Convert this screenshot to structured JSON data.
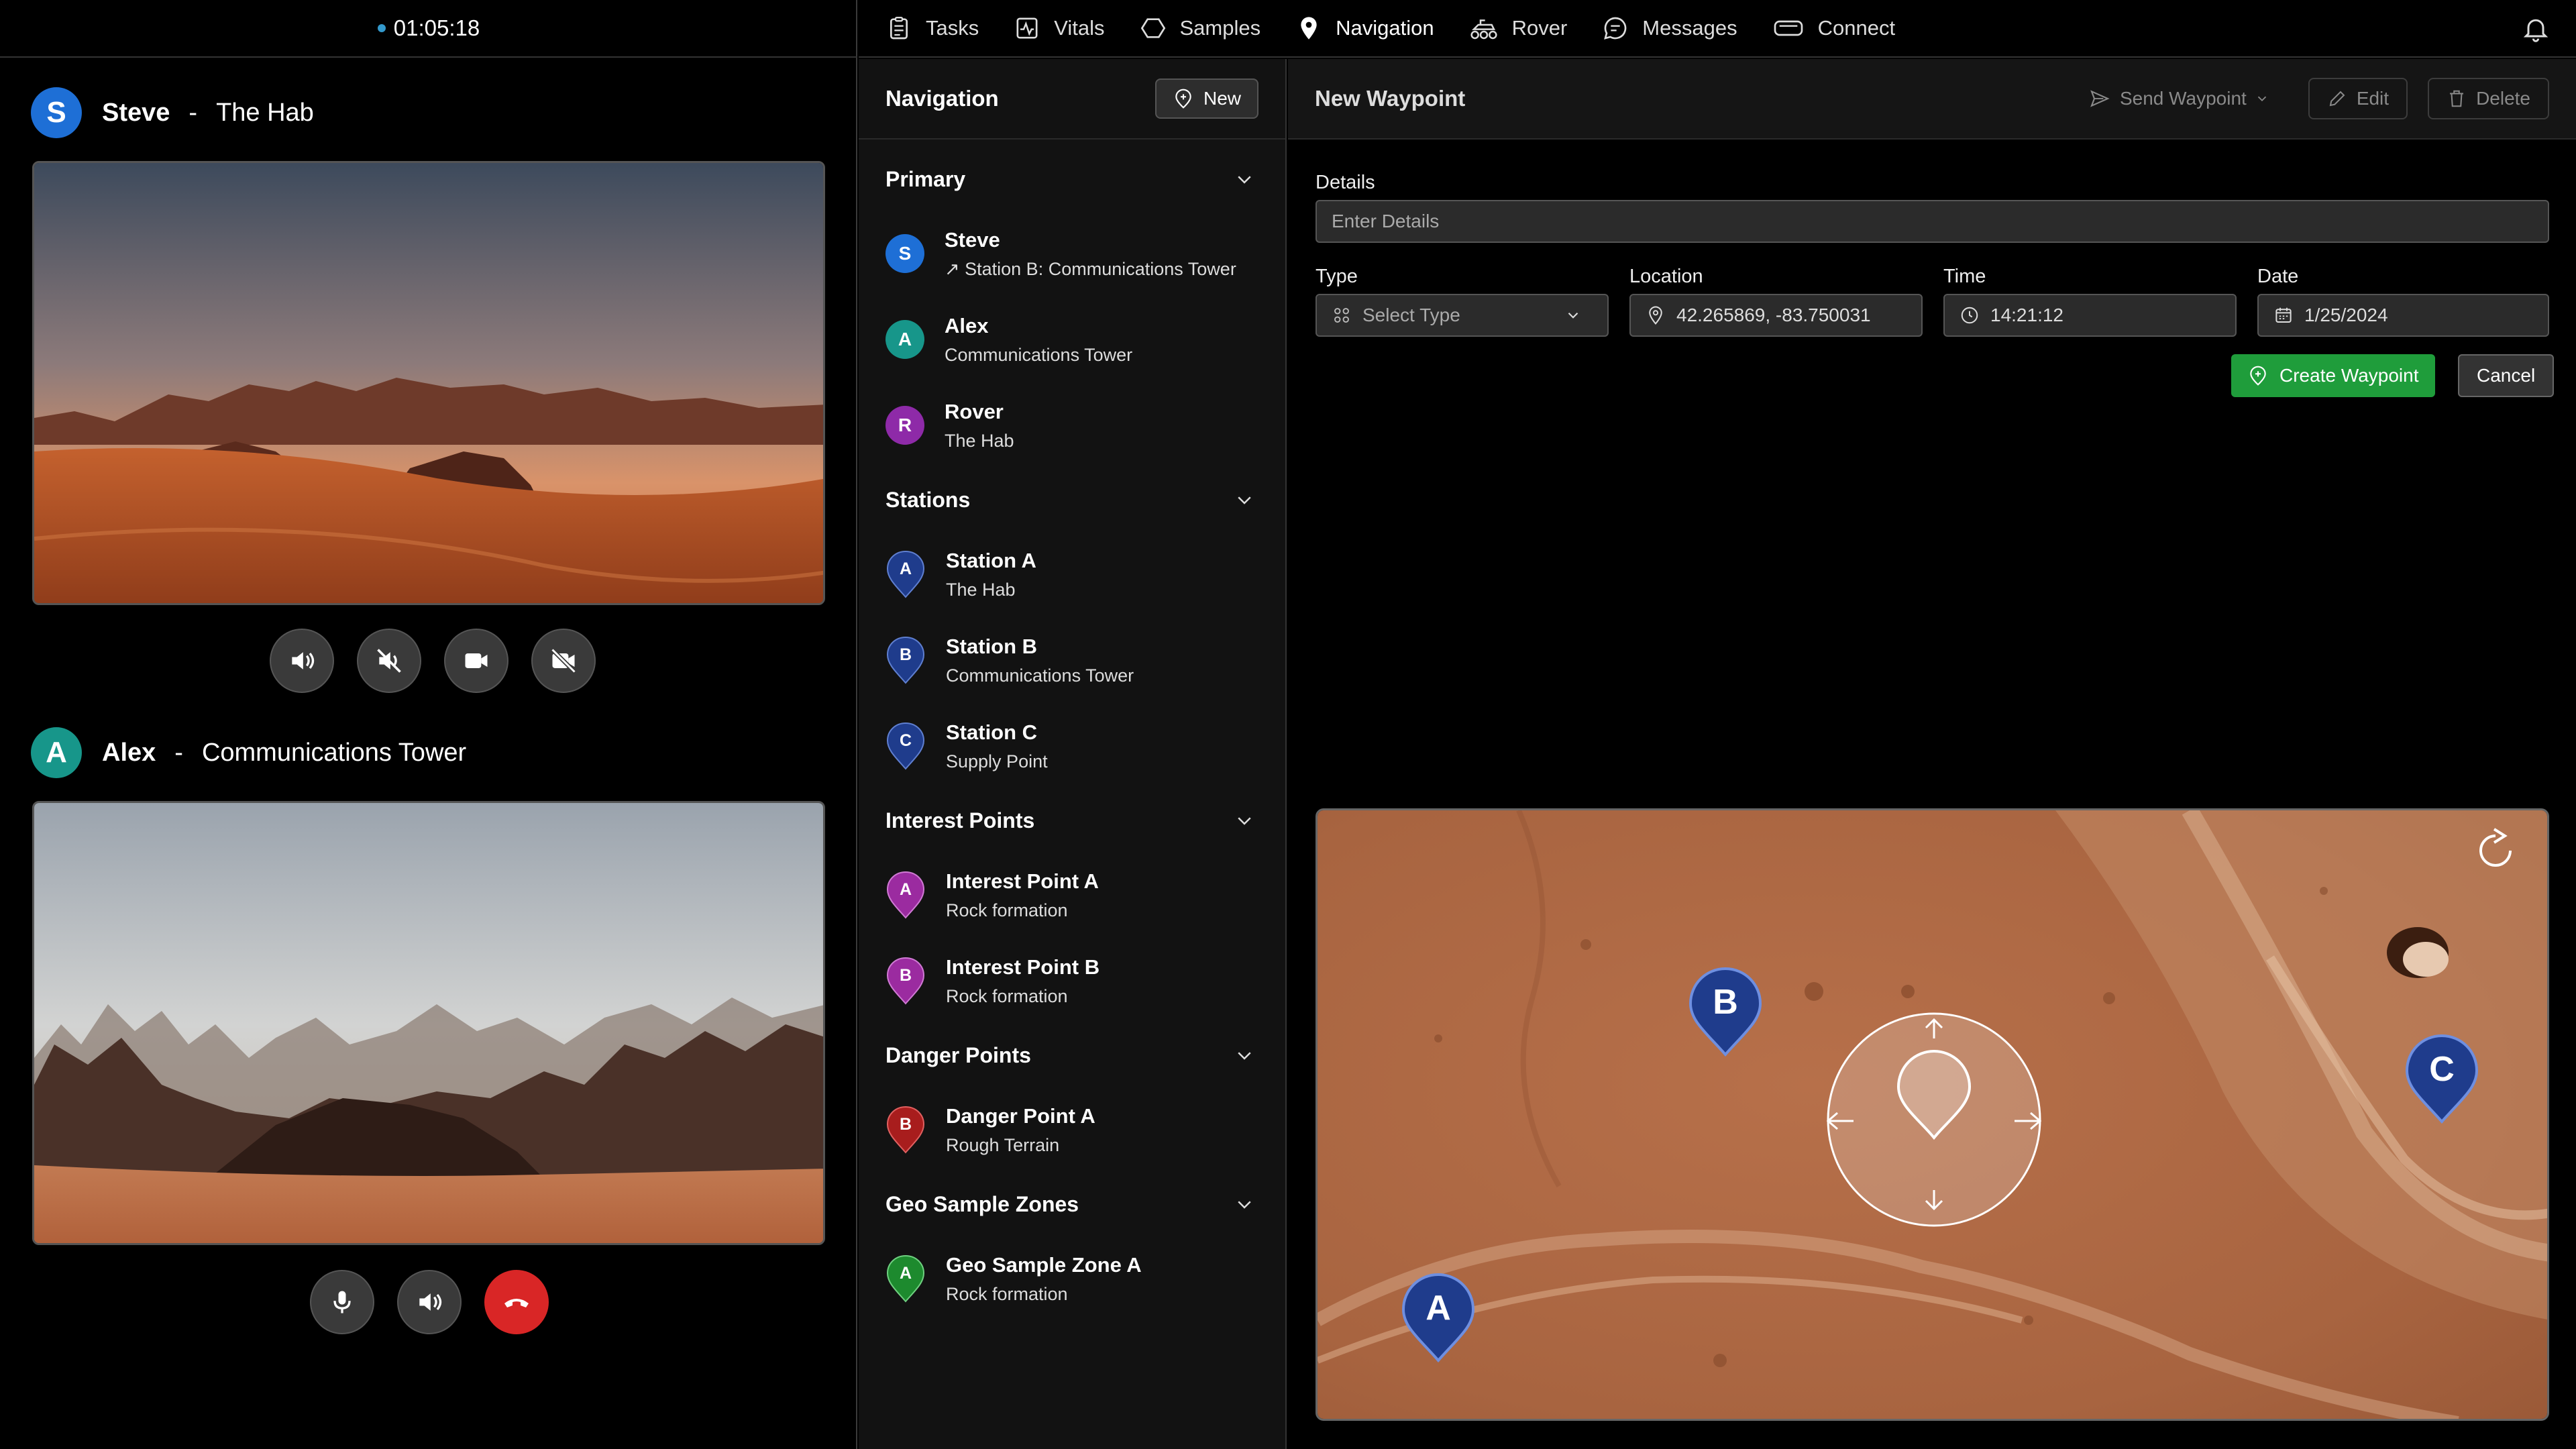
{
  "call": {
    "timer": "01:05:18",
    "callers": [
      {
        "initial": "S",
        "name": "Steve",
        "separator": "-",
        "location": "The Hab",
        "color": "#1e6fd6"
      },
      {
        "initial": "A",
        "name": "Alex",
        "separator": "-",
        "location": "Communications Tower",
        "color": "#17968a"
      }
    ],
    "controls_1": [
      "speaker-icon",
      "speaker-muted-icon",
      "camera-icon",
      "camera-off-icon"
    ],
    "controls_2": [
      "microphone-icon",
      "speaker-icon",
      "hang-up-icon"
    ]
  },
  "topnav": {
    "tabs": [
      {
        "label": "Tasks",
        "icon": "clipboard-icon"
      },
      {
        "label": "Vitals",
        "icon": "vitals-icon"
      },
      {
        "label": "Samples",
        "icon": "hexagon-icon"
      },
      {
        "label": "Navigation",
        "icon": "location-pin-icon",
        "active": true
      },
      {
        "label": "Rover",
        "icon": "rover-icon"
      },
      {
        "label": "Messages",
        "icon": "chat-icon"
      },
      {
        "label": "Connect",
        "icon": "headset-icon"
      }
    ],
    "notifications_icon": "bell-icon"
  },
  "navlist": {
    "title": "Navigation",
    "new_label": "New",
    "sections": {
      "primary": {
        "title": "Primary",
        "items": [
          {
            "initial": "S",
            "name": "Steve",
            "sub": "↗ Station B: Communications Tower",
            "color": "#1e6fd6"
          },
          {
            "initial": "A",
            "name": "Alex",
            "sub": "Communications Tower",
            "color": "#17968a"
          },
          {
            "initial": "R",
            "name": "Rover",
            "sub": "The Hab",
            "color": "#8e2aa8"
          }
        ]
      },
      "stations": {
        "title": "Stations",
        "items": [
          {
            "initial": "A",
            "name": "Station A",
            "sub": "The Hab",
            "color": "#1f3c8c"
          },
          {
            "initial": "B",
            "name": "Station B",
            "sub": "Communications Tower",
            "color": "#1f3c8c"
          },
          {
            "initial": "C",
            "name": "Station C",
            "sub": "Supply Point",
            "color": "#1f3c8c"
          }
        ]
      },
      "interest": {
        "title": "Interest Points",
        "items": [
          {
            "initial": "A",
            "name": "Interest Point A",
            "sub": "Rock formation",
            "color": "#9b2ba0"
          },
          {
            "initial": "B",
            "name": "Interest Point B",
            "sub": "Rock formation",
            "color": "#9b2ba0"
          }
        ]
      },
      "danger": {
        "title": "Danger Points",
        "items": [
          {
            "initial": "B",
            "name": "Danger Point A",
            "sub": "Rough Terrain",
            "color": "#a81d1d"
          }
        ]
      },
      "geo": {
        "title": "Geo Sample Zones",
        "items": [
          {
            "initial": "A",
            "name": "Geo Sample Zone A",
            "sub": "Rock formation",
            "color": "#1d8a2e"
          }
        ]
      }
    }
  },
  "waypoint": {
    "title": "New Waypoint",
    "send_label": "Send Waypoint",
    "edit_label": "Edit",
    "delete_label": "Delete",
    "details_label": "Details",
    "details_placeholder": "Enter Details",
    "type_label": "Type",
    "type_placeholder": "Select Type",
    "location_label": "Location",
    "location_value": "42.265869, -83.750031",
    "time_label": "Time",
    "time_value": "14:21:12",
    "date_label": "Date",
    "date_value": "1/25/2024",
    "create_label": "Create Waypoint",
    "cancel_label": "Cancel"
  },
  "map": {
    "markers": [
      "A",
      "B",
      "C"
    ],
    "marker_color": "#1f3c8c",
    "reset_icon": "refresh-icon"
  }
}
